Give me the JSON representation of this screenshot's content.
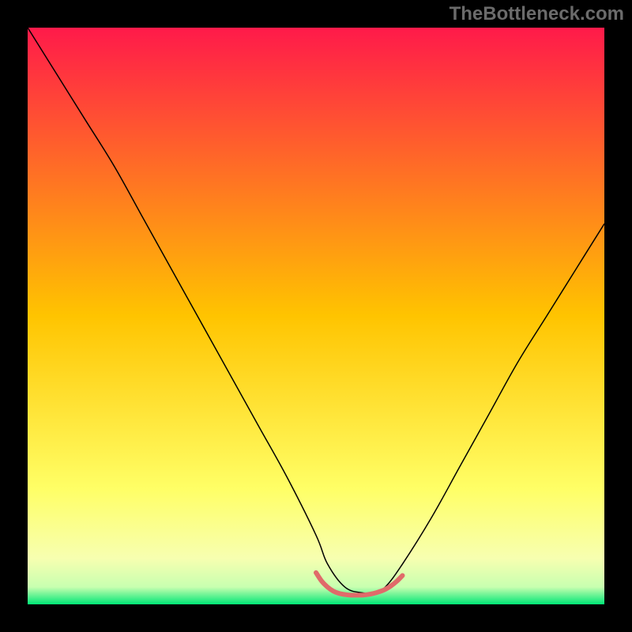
{
  "watermark": "TheBottleneck.com",
  "chart_data": {
    "type": "line",
    "title": "",
    "xlabel": "",
    "ylabel": "",
    "xlim": [
      0,
      100
    ],
    "ylim": [
      0,
      100
    ],
    "background_gradient": {
      "stops": [
        {
          "offset": 0.0,
          "color": "#ff1a4a"
        },
        {
          "offset": 0.5,
          "color": "#ffc400"
        },
        {
          "offset": 0.8,
          "color": "#ffff66"
        },
        {
          "offset": 0.92,
          "color": "#f7ffb0"
        },
        {
          "offset": 0.97,
          "color": "#c8ffb0"
        },
        {
          "offset": 1.0,
          "color": "#00e676"
        }
      ]
    },
    "series": [
      {
        "name": "bottleneck-curve",
        "color": "#000000",
        "width": 1.5,
        "x": [
          0,
          5,
          10,
          15,
          20,
          25,
          30,
          35,
          40,
          45,
          50,
          52,
          55,
          58,
          60,
          62,
          65,
          70,
          75,
          80,
          85,
          90,
          95,
          100
        ],
        "y": [
          100,
          92,
          84,
          76,
          67,
          58,
          49,
          40,
          31,
          22,
          12,
          7,
          3,
          2,
          2,
          3,
          7,
          15,
          24,
          33,
          42,
          50,
          58,
          66
        ]
      },
      {
        "name": "optimal-range",
        "color": "#e06a6a",
        "width": 6,
        "x": [
          50,
          51,
          52,
          53,
          54,
          55,
          56,
          57,
          58,
          59,
          60,
          61,
          62,
          63,
          64,
          65
        ],
        "y": [
          5.5,
          4.0,
          3.0,
          2.3,
          1.9,
          1.7,
          1.6,
          1.6,
          1.6,
          1.7,
          1.9,
          2.2,
          2.6,
          3.2,
          4.0,
          5.0
        ]
      }
    ]
  }
}
